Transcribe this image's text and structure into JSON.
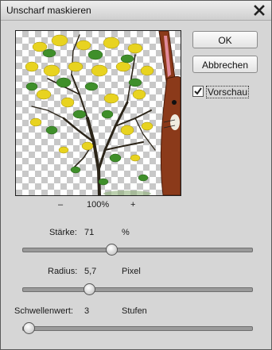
{
  "dialog": {
    "title": "Unscharf maskieren",
    "close_icon": "close-icon"
  },
  "preview": {
    "zoom_minus": "–",
    "zoom_value": "100%",
    "zoom_plus": "+"
  },
  "buttons": {
    "ok": "OK",
    "cancel": "Abbrechen"
  },
  "preview_checkbox": {
    "label": "Vorschau",
    "checked": true
  },
  "params": {
    "amount": {
      "label": "Stärke:",
      "value": "71",
      "unit": "%",
      "slider_fraction": 0.38
    },
    "radius": {
      "label": "Radius:",
      "value": "5,7",
      "unit": "Pixel",
      "slider_fraction": 0.28
    },
    "threshold": {
      "label": "Schwellenwert:",
      "value": "3",
      "unit": "Stufen",
      "slider_fraction": 0.0
    }
  },
  "colors": {
    "dialog_bg": "#d6d6d6",
    "foliage_yellow": "#e8d320",
    "foliage_green": "#3f8f2a",
    "rabbit_brown": "#8b3a1a"
  }
}
